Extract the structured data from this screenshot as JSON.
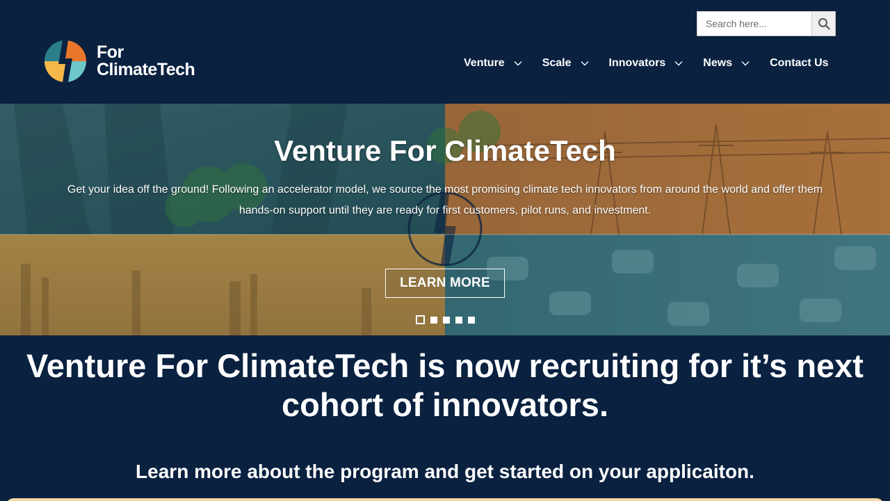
{
  "brand": {
    "logo_line1": "For",
    "logo_line2": "ClimateTech",
    "colors": {
      "navy": "#0a2140",
      "teal": "#2a7f88",
      "orange": "#e9772b",
      "yellow": "#f7b84a",
      "light_teal": "#6ec7c9"
    }
  },
  "search": {
    "placeholder": "Search here...",
    "button_icon": "search-icon"
  },
  "nav": {
    "items": [
      {
        "label": "Venture",
        "has_dropdown": true
      },
      {
        "label": "Scale",
        "has_dropdown": true
      },
      {
        "label": "Innovators",
        "has_dropdown": true
      },
      {
        "label": "News",
        "has_dropdown": true
      },
      {
        "label": "Contact Us",
        "has_dropdown": false
      }
    ]
  },
  "hero": {
    "title": "Venture For ClimateTech",
    "description": "Get your idea off the ground! Following an accelerator model, we source the most promising climate tech innovators from around the world and offer them hands-on support until they are ready for first customers, pilot runs, and investment.",
    "button_label": "LEARN MORE",
    "slides_total": 5,
    "active_slide": 1
  },
  "main": {
    "headline": "Venture For ClimateTech is now recruiting for it’s next cohort of innovators.",
    "subheadline": "Learn more about the program and get started on your applicaiton."
  }
}
